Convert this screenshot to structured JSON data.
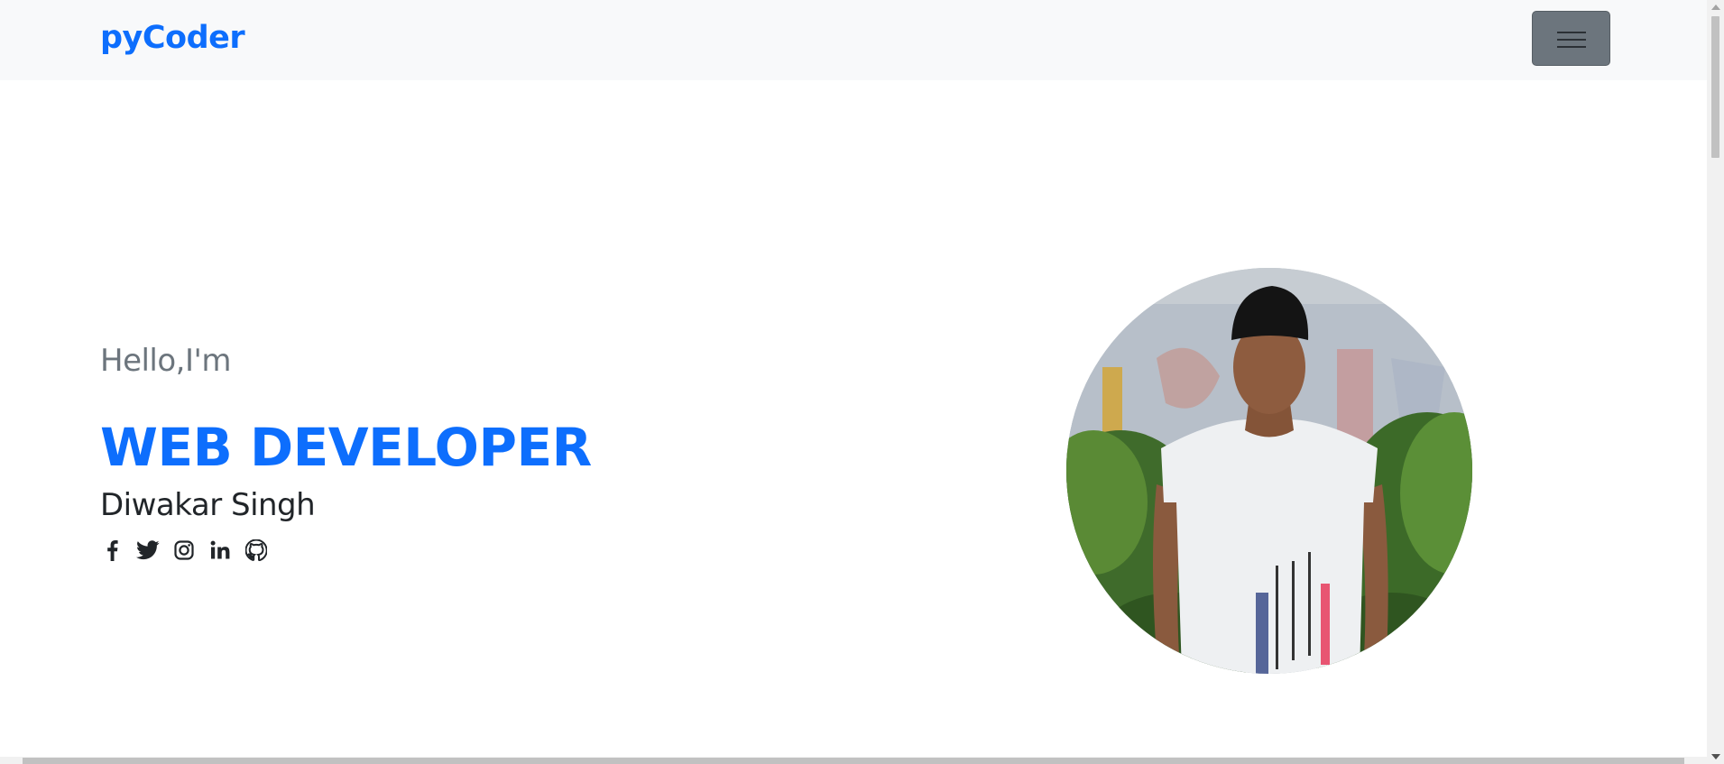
{
  "navbar": {
    "brand": "pyCoder",
    "toggler_icon": "hamburger-icon"
  },
  "hero": {
    "greeting": "Hello,I'm",
    "role": "WEB DEVELOPER",
    "name": "Diwakar Singh",
    "socials": [
      {
        "icon": "facebook-icon"
      },
      {
        "icon": "twitter-icon"
      },
      {
        "icon": "instagram-icon"
      },
      {
        "icon": "linkedin-icon"
      },
      {
        "icon": "github-icon"
      }
    ],
    "photo_alt": "profile photo"
  },
  "colors": {
    "brand": "#0d6efd",
    "navbar_bg": "#f8f9fa",
    "toggler_bg": "#6c757d",
    "muted_text": "#6c757d",
    "dark_text": "#212529"
  }
}
